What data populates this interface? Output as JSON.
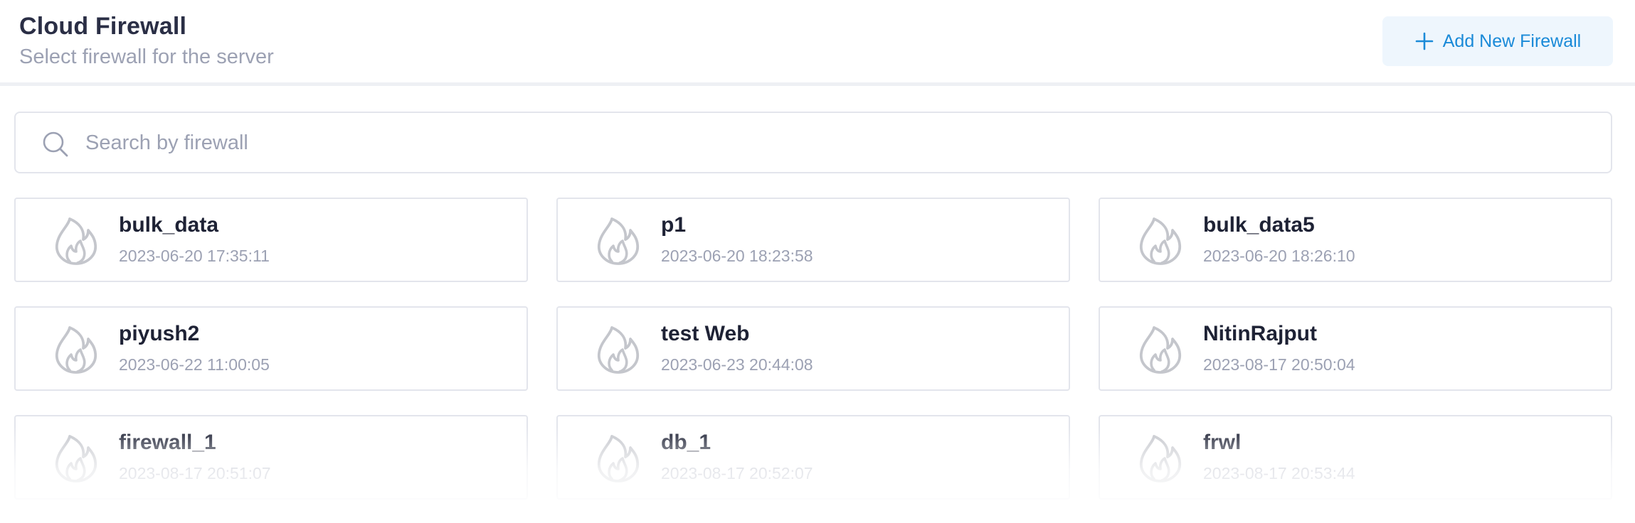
{
  "header": {
    "title": "Cloud Firewall",
    "subtitle": "Select firewall for the server",
    "add_button_label": "Add New Firewall"
  },
  "search": {
    "placeholder": "Search by firewall",
    "value": ""
  },
  "firewalls": [
    {
      "name": "bulk_data",
      "created": "2023-06-20 17:35:11"
    },
    {
      "name": "p1",
      "created": "2023-06-20 18:23:58"
    },
    {
      "name": "bulk_data5",
      "created": "2023-06-20 18:26:10"
    },
    {
      "name": "piyush2",
      "created": "2023-06-22 11:00:05"
    },
    {
      "name": "test Web",
      "created": "2023-06-23 20:44:08"
    },
    {
      "name": "NitinRajput",
      "created": "2023-08-17 20:50:04"
    },
    {
      "name": "firewall_1",
      "created": "2023-08-17 20:51:07"
    },
    {
      "name": "db_1",
      "created": "2023-08-17 20:52:07"
    },
    {
      "name": "frwl",
      "created": "2023-08-17 20:53:44"
    }
  ],
  "icons": {
    "search": "search-icon",
    "add": "plus-icon",
    "firewall": "fire-icon"
  },
  "colors": {
    "accent": "#1a8ad8",
    "accent_bg": "#eef6fd",
    "title": "#2a2e45",
    "muted": "#9ca1b3",
    "border": "#e3e5ec",
    "icon_gray": "#c4c6cc"
  }
}
